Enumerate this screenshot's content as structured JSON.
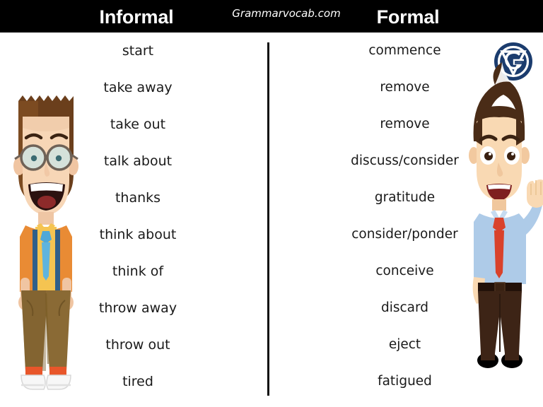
{
  "header": {
    "left_title": "Informal",
    "site_name": "Grammarvocab.com",
    "right_title": "Formal",
    "bar_color": "#000000",
    "text_color": "#ffffff"
  },
  "logo": {
    "name": "grammarvocab-gv-logo",
    "letter_g": "G",
    "letter_v": "V",
    "circle_color": "#1b3c6e",
    "mark_color": "#ffffff"
  },
  "divider": {
    "color": "#111111"
  },
  "columns": {
    "informal_label": "Informal",
    "formal_label": "Formal"
  },
  "pairs": [
    {
      "informal": "start",
      "formal": "commence"
    },
    {
      "informal": "take away",
      "formal": "remove"
    },
    {
      "informal": "take out",
      "formal": "remove"
    },
    {
      "informal": "talk about",
      "formal": "discuss/consider"
    },
    {
      "informal": "thanks",
      "formal": "gratitude"
    },
    {
      "informal": "think about",
      "formal": "consider/ponder"
    },
    {
      "informal": "think of",
      "formal": "conceive"
    },
    {
      "informal": "throw away",
      "formal": "discard"
    },
    {
      "informal": "throw out",
      "formal": "eject"
    },
    {
      "informal": "tired",
      "formal": "fatigued"
    }
  ],
  "characters": {
    "informal": {
      "name": "casual-boy-illustration",
      "hair_color": "#7a4a21",
      "skin_color": "#f3ccad",
      "shirt_color": "#f2a03c",
      "tie_color": "#4fa8d8",
      "pants_color": "#8a6a35",
      "shoe_color": "#ffffff",
      "shoe_accent": "#e8562a",
      "glasses_color": "#6f6257"
    },
    "formal": {
      "name": "businessman-illustration",
      "hair_color": "#4a2c17",
      "skin_color": "#f7d2ab",
      "shirt_color": "#aecbe8",
      "tie_color": "#d9422b",
      "pants_color": "#3d2416",
      "belt_color": "#221109",
      "shoe_color": "#000000"
    }
  }
}
